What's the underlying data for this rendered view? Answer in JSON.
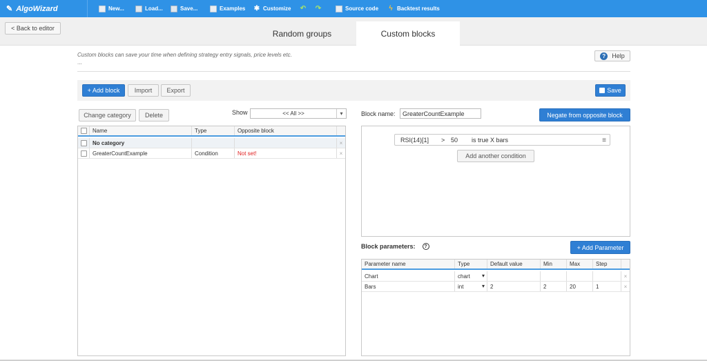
{
  "brand": {
    "name": "AlgoWizard"
  },
  "toolbar": {
    "new": "New...",
    "load": "Load...",
    "save": "Save...",
    "examples": "Examples",
    "customize": "Customize",
    "source_code": "Source code",
    "backtest_results": "Backtest results"
  },
  "nav": {
    "back": "< Back to editor"
  },
  "tabs": {
    "random": "Random groups",
    "custom": "Custom blocks"
  },
  "description": {
    "line1": "Custom blocks can save your time when defining strategy entry signals, price levels etc.",
    "line2": "..."
  },
  "help": {
    "label": "Help",
    "icon_text": "?"
  },
  "actions": {
    "add_block": "+ Add block",
    "import": "Import",
    "export": "Export",
    "save": "Save",
    "change_category": "Change category",
    "delete": "Delete"
  },
  "show_filter": {
    "label": "Show",
    "value": "<< All >>"
  },
  "blocks_table": {
    "headers": [
      "Name",
      "Type",
      "Opposite block"
    ],
    "rows": [
      {
        "name": "No category",
        "type": "",
        "opposite": "",
        "x": "×"
      },
      {
        "name": "GreaterCountExample",
        "type": "Condition",
        "opposite": "Not set!",
        "x": "×"
      }
    ]
  },
  "block_name": {
    "label": "Block name:",
    "value": "GreaterCountExample"
  },
  "negate_button": "Negate from opposite block",
  "condition": {
    "left": "RSI(14)[1]",
    "op": ">",
    "right": "50",
    "suffix": "is true X bars",
    "add_another": "Add another condition"
  },
  "block_parameters": {
    "label": "Block parameters:",
    "q": "?",
    "add": "+ Add Parameter",
    "headers": [
      "Parameter name",
      "Type",
      "Default value",
      "Min",
      "Max",
      "Step"
    ],
    "rows": [
      {
        "name": "Chart",
        "type": "chart",
        "default": "",
        "min": "",
        "max": "",
        "step": "",
        "x": "×"
      },
      {
        "name": "Bars",
        "type": "int",
        "default": "2",
        "min": "2",
        "max": "20",
        "step": "1",
        "x": "×"
      }
    ]
  },
  "icons": {
    "dropdown": "▾",
    "menu": "≡"
  }
}
